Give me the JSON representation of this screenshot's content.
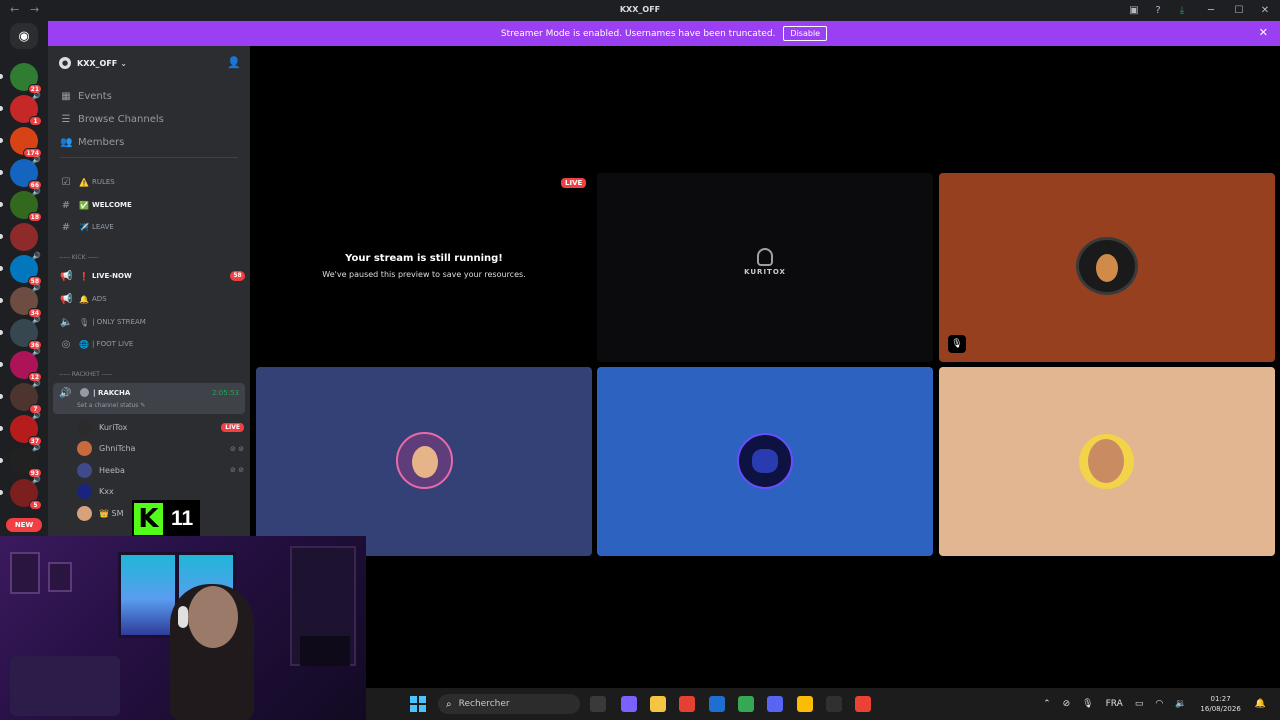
{
  "window": {
    "title": "KXX_OFF",
    "back_arrow": "←",
    "forward_arrow": "→",
    "top_icons": [
      "inbox-icon",
      "help-icon",
      "download-icon",
      "minimize-icon",
      "maximize-icon",
      "close-icon"
    ],
    "top_glyphs": [
      "▣",
      "?",
      "⤓",
      "─",
      "☐",
      "✕"
    ]
  },
  "banner": {
    "text": "Streamer Mode is enabled. Usernames have been truncated.",
    "button": "Disable",
    "close": "✕",
    "color": "#9b3ff2"
  },
  "guilds": {
    "home_glyph": "◉",
    "servers": [
      {
        "badge": "21",
        "color": "#2e7d32"
      },
      {
        "badge": "1",
        "color": "#c62828",
        "vol": "🔊"
      },
      {
        "badge": "174",
        "color": "#d84315"
      },
      {
        "badge": "66",
        "color": "#1565c0",
        "vol": "🔊"
      },
      {
        "badge": "18",
        "color": "#33691e",
        "vol": "🔊"
      },
      {
        "badge": "",
        "color": "#8e2a2a"
      },
      {
        "badge": "58",
        "color": "#0277bd",
        "vol": "🔊"
      },
      {
        "badge": "34",
        "color": "#6d4c41",
        "vol": "🔊"
      },
      {
        "badge": "36",
        "color": "#37474f",
        "vol": "🔊"
      },
      {
        "badge": "12",
        "color": "#ad1457",
        "vol": "🔊"
      },
      {
        "badge": "7",
        "color": "#4e342e",
        "vol": "🔊"
      },
      {
        "badge": "37",
        "color": "#b71c1c",
        "vol": "🔊"
      },
      {
        "badge": "93",
        "color": "#212121",
        "vol": "🔊"
      },
      {
        "badge": "5",
        "color": "#7b1f1f",
        "vol": "🔊"
      }
    ],
    "new_label": "NEW"
  },
  "sidebar": {
    "guild_name": "KXX_OFF",
    "caret": "⌄",
    "invite_glyph": "👤",
    "nav": [
      {
        "label": "Events",
        "icon": "calendar-icon",
        "glyph": "▦"
      },
      {
        "label": "Browse Channels",
        "icon": "browse-icon",
        "glyph": "☰"
      },
      {
        "label": "Members",
        "icon": "members-icon",
        "glyph": "👥"
      }
    ],
    "channels_top": [
      {
        "label": "RULES",
        "icon": "rules-icon",
        "glyph": "☑",
        "emoji": "⚠️"
      },
      {
        "label": "WELCOME",
        "icon": "hash-icon",
        "glyph": "#",
        "emoji": "✅",
        "active": true
      },
      {
        "label": "LEAVE",
        "icon": "hash-icon",
        "glyph": "#",
        "emoji": "✈️"
      }
    ],
    "category_kick": "----- KICK -----",
    "channels_kick": [
      {
        "label": "LIVE-NOW",
        "icon": "announcement-icon",
        "glyph": "📢",
        "emoji": "❗",
        "badge": "58",
        "active": true
      },
      {
        "label": "ADS",
        "icon": "announcement-icon",
        "glyph": "📢",
        "emoji": "🔔"
      },
      {
        "label": "| ONLY STREAM",
        "icon": "voice-icon",
        "glyph": "🔈",
        "emoji": "🎙"
      },
      {
        "label": "| FOOT LIVE",
        "icon": "stage-icon",
        "glyph": "◎",
        "emoji": "🌐"
      }
    ],
    "category_rackhet": "----- RACKHET -----",
    "voice_channel": {
      "name": "| RAKCHA",
      "timer": "2:05:53",
      "status": "Set a channel status ✎"
    },
    "voice_users": [
      {
        "name": "KuriTox",
        "right": "LIVE",
        "color": "#2b2b2b"
      },
      {
        "name": "GhniTcha",
        "right": "⊘ ⊘",
        "color": "#c66b3d"
      },
      {
        "name": "Heeba",
        "right": "⊘ ⊘",
        "color": "#3f4a8a"
      },
      {
        "name": "Kxx",
        "right": "",
        "color": "#1a237e"
      },
      {
        "name": "👑 SM",
        "right": "",
        "color": "#d7a27a"
      }
    ]
  },
  "kick": {
    "logo": "K",
    "number": "11"
  },
  "stage": {
    "stream_title": "Your stream is still running!",
    "stream_sub": "We've paused this preview to save your resources.",
    "live_label": "LIVE",
    "kuritox_text": "KURITOX",
    "tiles": [
      {
        "name": "my-stream-tile",
        "color": "#000000"
      },
      {
        "name": "kuritox-tile",
        "color": "#0b0b0e"
      },
      {
        "name": "ghnitcha-tile",
        "color": "#96401f",
        "avatar": "#b85c2e"
      },
      {
        "name": "heeba-tile",
        "color": "#334176",
        "avatar": "#7c5a9c"
      },
      {
        "name": "kxx-tile",
        "color": "#2e62c0",
        "avatar": "#1a2370"
      },
      {
        "name": "sm-tile",
        "color": "#e1b690",
        "avatar": "#c48a5c"
      }
    ],
    "mute_glyph": "🎙"
  },
  "taskbar": {
    "search_placeholder": "Rechercher",
    "search_glyph": "⌕",
    "apps": [
      {
        "name": "task-view-icon",
        "color": "#3a3a3a"
      },
      {
        "name": "copilot-icon",
        "color": "#7b61ff"
      },
      {
        "name": "file-explorer-icon",
        "color": "#f4c542"
      },
      {
        "name": "chrome-icon",
        "color": "#e44134"
      },
      {
        "name": "app-icon-blue",
        "color": "#1f6fd1"
      },
      {
        "name": "chrome-icon-2",
        "color": "#34a853"
      },
      {
        "name": "discord-taskbar-icon",
        "color": "#5865f2"
      },
      {
        "name": "chrome-icon-3",
        "color": "#fbbc05"
      },
      {
        "name": "obs-icon",
        "color": "#303030"
      },
      {
        "name": "chrome-icon-4",
        "color": "#ea4335"
      }
    ],
    "tray": {
      "chevron": "⌃",
      "lang": "FRA",
      "time": "01:27",
      "date": "16/08/2026"
    }
  }
}
